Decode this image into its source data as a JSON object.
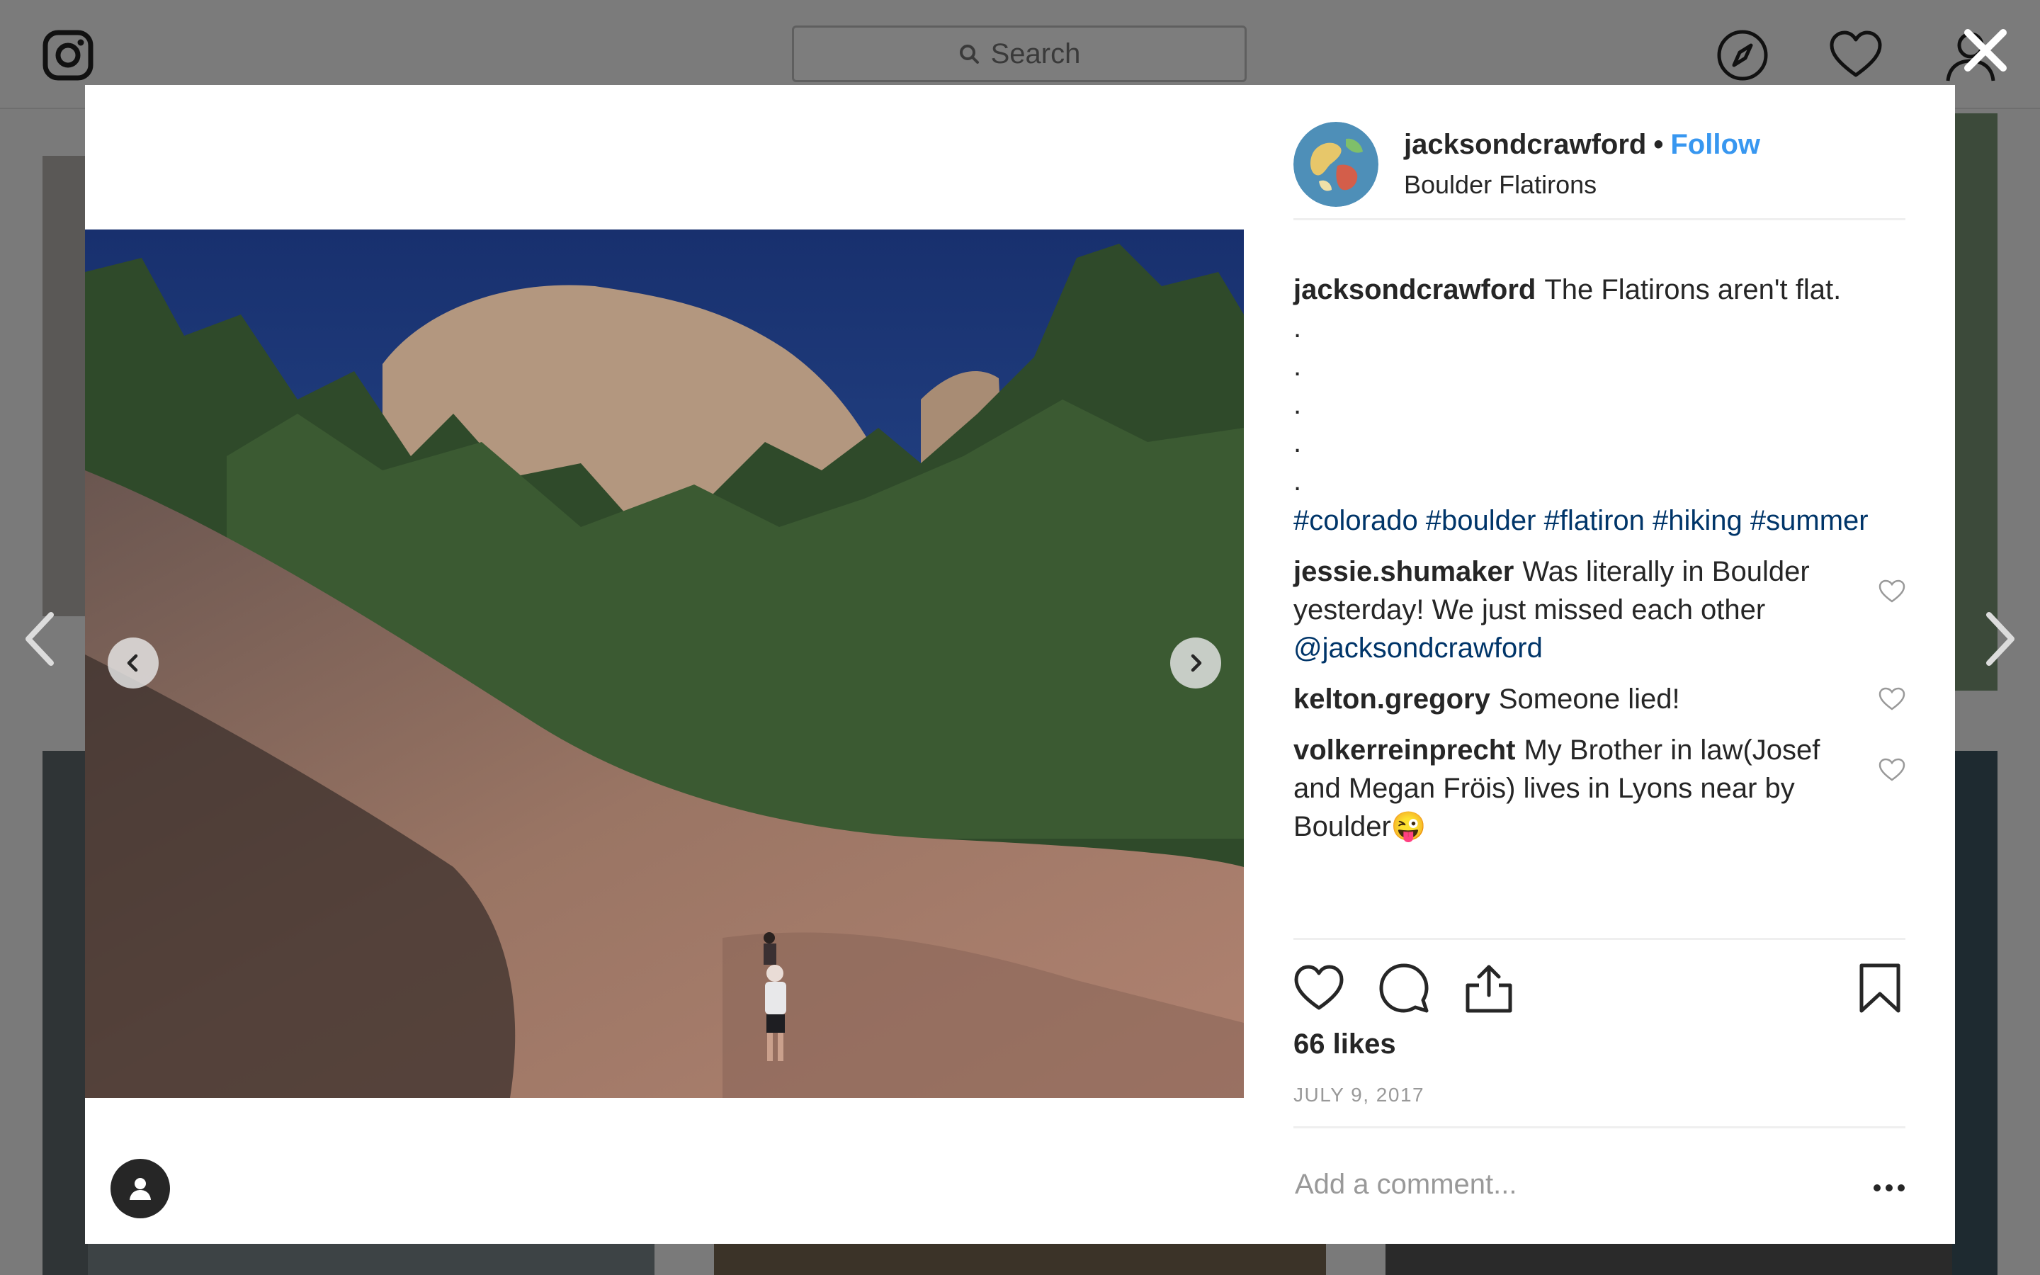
{
  "topbar": {
    "search_placeholder": "Search",
    "icons": [
      "instagram-icon",
      "search-icon",
      "explore-icon",
      "heart-icon",
      "profile-icon"
    ]
  },
  "overlay": {
    "close_icon": "close-icon",
    "prev_icon": "chevron-left-icon",
    "next_icon": "chevron-right-icon"
  },
  "post": {
    "username": "jacksondcrawford",
    "separator": "•",
    "follow_label": "Follow",
    "location": "Boulder Flatirons",
    "caption": {
      "username": "jacksondcrawford",
      "text": "The Flatirons aren't flat.",
      "dots": [
        ".",
        ".",
        ".",
        ".",
        "."
      ],
      "hashtags": "#colorado #boulder #flatiron #hiking #summer"
    },
    "comments": [
      {
        "username": "jessie.shumaker",
        "text": "Was literally in Boulder yesterday! We just missed each other",
        "mention": "@jacksondcrawford"
      },
      {
        "username": "kelton.gregory",
        "text": "Someone lied!"
      },
      {
        "username": "volkerreinprecht",
        "text": "My Brother in law(Josef and Megan Fröis) lives in Lyons near by Boulder😜"
      }
    ],
    "likes": "66 likes",
    "date": "JULY 9, 2017",
    "add_comment_placeholder": "Add a comment...",
    "action_icons": [
      "like-icon",
      "comment-icon",
      "share-icon",
      "save-icon"
    ]
  },
  "colors": {
    "link_blue": "#3897f0",
    "hashtag_blue": "#003569",
    "text": "#262626",
    "muted": "#999999"
  }
}
